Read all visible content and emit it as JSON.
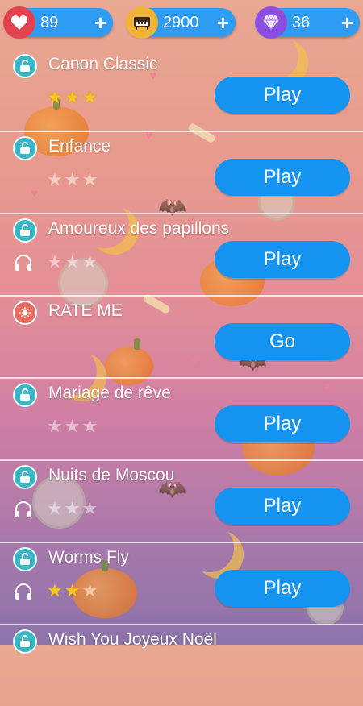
{
  "resources": {
    "lives": {
      "value": "89",
      "icon": "heart-icon",
      "plus": "+"
    },
    "coins": {
      "value": "2900",
      "icon": "piano-icon",
      "plus": "+"
    },
    "gems": {
      "value": "36",
      "icon": "diamond-icon",
      "plus": "+"
    }
  },
  "songs": [
    {
      "title": "Canon Classic",
      "stars": 3,
      "button": "Play",
      "headphones": false
    },
    {
      "title": "Enfance",
      "stars": 0,
      "button": "Play",
      "headphones": false
    },
    {
      "title": "Amoureux des papillons",
      "stars": 0,
      "button": "Play",
      "headphones": true
    },
    {
      "title": "RATE ME",
      "stars": null,
      "button": "Go",
      "headphones": false
    },
    {
      "title": "Mariage de rêve",
      "stars": 0,
      "button": "Play",
      "headphones": false
    },
    {
      "title": "Nuits de Moscou",
      "stars": 0,
      "button": "Play",
      "headphones": true
    },
    {
      "title": "Worms Fly",
      "stars": 2,
      "button": "Play",
      "headphones": true
    },
    {
      "title": "Wish You Joyeux Noël",
      "stars": null,
      "button": null,
      "headphones": false
    }
  ],
  "colors": {
    "accent": "#1593f0",
    "star": "#f6c51f",
    "lock": "#39b6c6"
  }
}
